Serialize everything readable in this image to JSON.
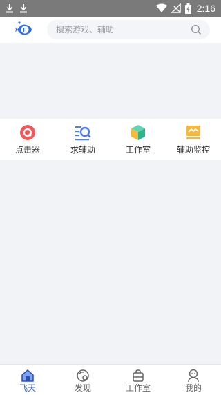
{
  "status_bar": {
    "time": "2:16",
    "left_icons": [
      "download-icon",
      "download-icon"
    ],
    "right_icons": [
      "wifi-icon",
      "no-signal-icon",
      "battery-charging-icon"
    ]
  },
  "header": {
    "logo": "fish-logo-icon",
    "search": {
      "placeholder": "搜索游戏、辅助",
      "icon": "search-icon"
    }
  },
  "tools": [
    {
      "label": "点击器",
      "icon": "clicker-icon",
      "color": "#f15a5a"
    },
    {
      "label": "求辅助",
      "icon": "search-list-icon",
      "color": "#4a7df0"
    },
    {
      "label": "工作室",
      "icon": "cube-icon",
      "color": "#3cc8a0"
    },
    {
      "label": "辅助监控",
      "icon": "monitor-icon",
      "color": "#f6b73c"
    }
  ],
  "bottom_nav": [
    {
      "label": "飞天",
      "icon": "home-icon",
      "active": true
    },
    {
      "label": "发现",
      "icon": "discover-icon",
      "active": false
    },
    {
      "label": "工作室",
      "icon": "bag-icon",
      "active": false
    },
    {
      "label": "我的",
      "icon": "profile-icon",
      "active": false
    }
  ],
  "colors": {
    "accent": "#3a66e0",
    "status_bar": "#7a7a7a",
    "background": "#f2f3f7"
  }
}
